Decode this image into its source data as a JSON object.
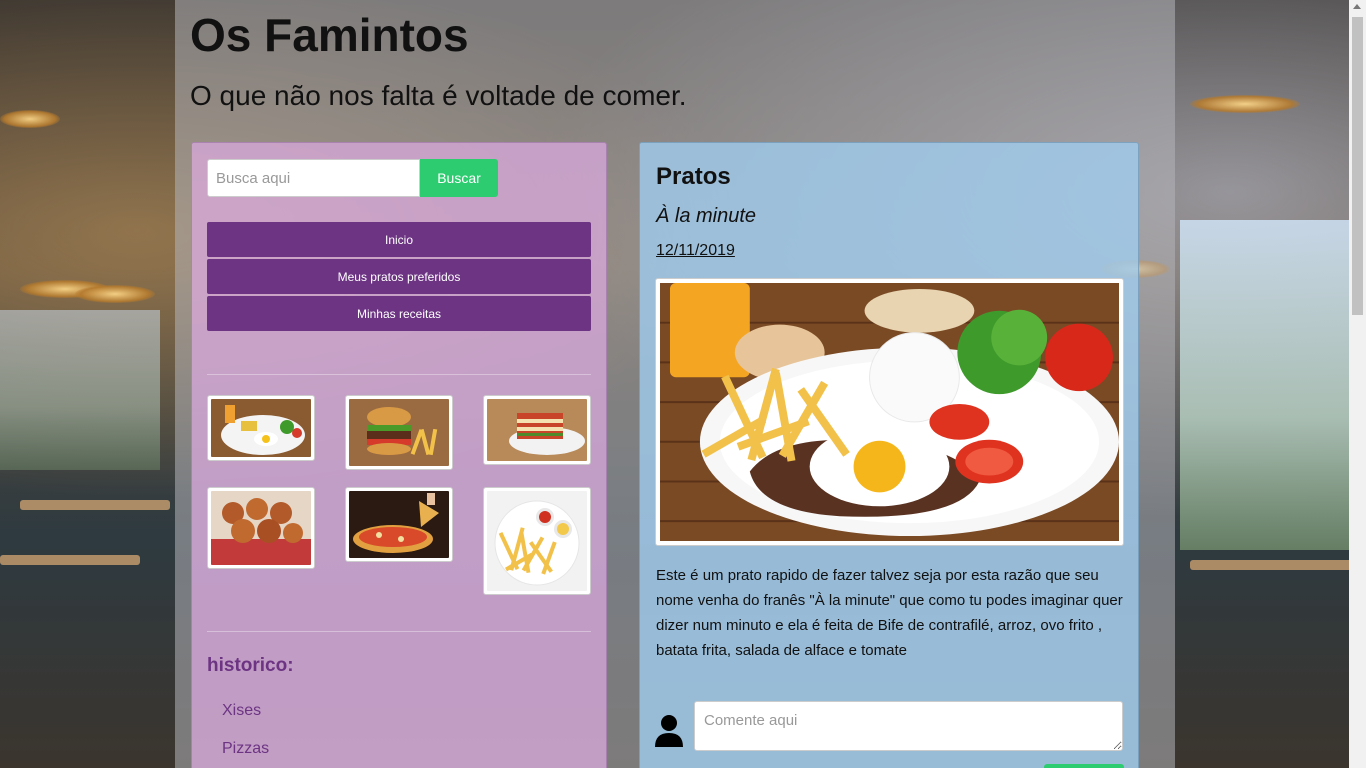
{
  "header": {
    "title": "Os Famintos",
    "subtitle": "O que não nos falta é voltade de comer."
  },
  "search": {
    "placeholder": "Busca aqui",
    "button_label": "Buscar"
  },
  "nav": {
    "items": [
      {
        "label": "Inicio"
      },
      {
        "label": "Meus pratos preferidos"
      },
      {
        "label": "Minhas receitas"
      }
    ]
  },
  "gallery": {
    "thumbnails": [
      {
        "icon": "steak-plate-image"
      },
      {
        "icon": "burger-image"
      },
      {
        "icon": "lasagna-image"
      },
      {
        "icon": "coxinha-image"
      },
      {
        "icon": "pizza-image"
      },
      {
        "icon": "fries-image"
      }
    ]
  },
  "history": {
    "title": "historico:",
    "items": [
      {
        "label": "Xises"
      },
      {
        "label": "Pizzas"
      }
    ]
  },
  "main": {
    "heading": "Pratos",
    "dish_name": "À la minute",
    "date": "12/11/2019",
    "description": "Este é um prato rapido de fazer talvez seja por esta razão que seu nome venha do franês \"À la minute\" que como tu podes imaginar quer dizer num minuto e ela é feita de Bife de contrafilé, arroz, ovo frito , batata frita, salada de alface e tomate",
    "comment_placeholder": "Comente aqui"
  },
  "colors": {
    "accent_green": "#2ecc71",
    "nav_purple": "#6c3483",
    "sidebar_bg": "#dcaae1",
    "main_bg": "#a0cdf0"
  }
}
